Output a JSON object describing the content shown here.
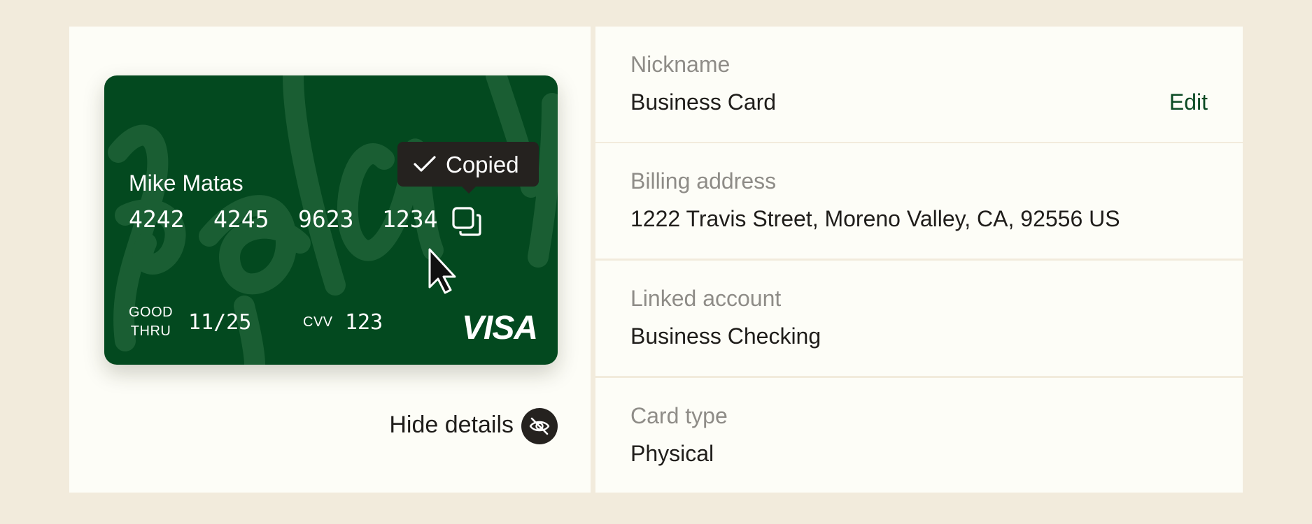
{
  "card": {
    "cardholder": "Mike Matas",
    "number_groups": [
      "4242",
      "4245",
      "9623",
      "1234"
    ],
    "good_thru_line1": "GOOD",
    "good_thru_line2": "THRU",
    "expiry": "11/25",
    "cvv_label": "CVV",
    "cvv": "123",
    "network": "VISA",
    "background_color": "#03491f"
  },
  "tooltip": {
    "text": "Copied",
    "icon": "check-icon"
  },
  "hide_details": {
    "label": "Hide details",
    "icon": "eye-off-icon"
  },
  "details": [
    {
      "label": "Nickname",
      "value": "Business Card",
      "action": "Edit"
    },
    {
      "label": "Billing address",
      "value": "1222 Travis Street, Moreno Valley, CA, 92556 US"
    },
    {
      "label": "Linked account",
      "value": "Business Checking"
    },
    {
      "label": "Card type",
      "value": "Physical"
    }
  ],
  "colors": {
    "background": "#f2ebdc",
    "surface": "#fdfdf7",
    "accent": "#0b4a24",
    "muted_text": "#8e8c87"
  }
}
